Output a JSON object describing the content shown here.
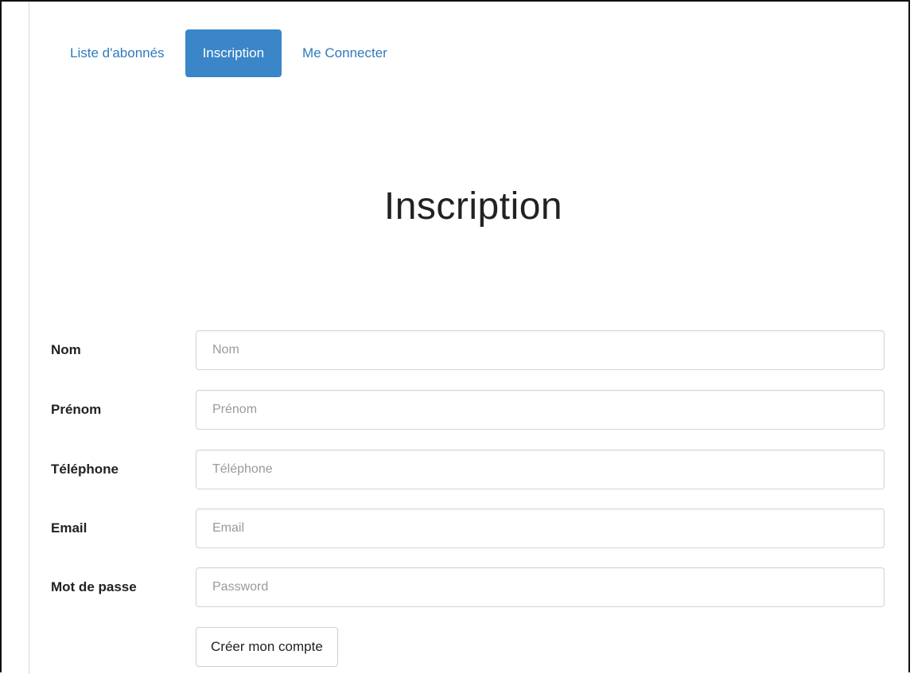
{
  "nav": {
    "tabs": [
      {
        "label": "Liste d'abonnés",
        "active": false
      },
      {
        "label": "Inscription",
        "active": true
      },
      {
        "label": "Me Connecter",
        "active": false
      }
    ]
  },
  "page": {
    "title": "Inscription"
  },
  "form": {
    "fields": [
      {
        "label": "Nom",
        "placeholder": "Nom",
        "value": ""
      },
      {
        "label": "Prénom",
        "placeholder": "Prénom",
        "value": ""
      },
      {
        "label": "Téléphone",
        "placeholder": "Téléphone",
        "value": ""
      },
      {
        "label": "Email",
        "placeholder": "Email",
        "value": ""
      },
      {
        "label": "Mot de passe",
        "placeholder": "Password",
        "value": ""
      }
    ],
    "submit_label": "Créer mon compte"
  },
  "colors": {
    "accent": "#3a86c8",
    "link": "#2e7bbd"
  }
}
